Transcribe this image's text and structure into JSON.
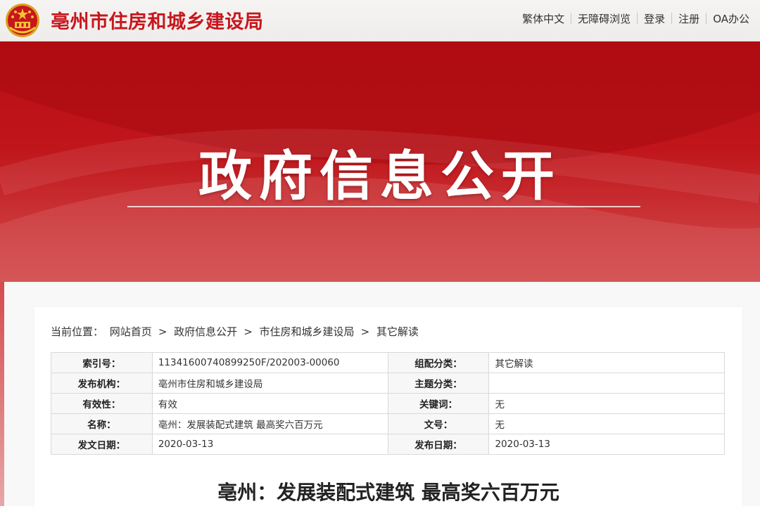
{
  "header": {
    "site_title": "亳州市住房和城乡建设局",
    "links": [
      "繁体中文",
      "无障碍浏览",
      "登录",
      "注册",
      "OA办公"
    ]
  },
  "banner": {
    "title": "政府信息公开"
  },
  "breadcrumb": {
    "prefix": "当前位置：",
    "items": [
      "网站首页",
      "政府信息公开",
      "市住房和城乡建设局",
      "其它解读"
    ]
  },
  "meta": {
    "rows": [
      {
        "k1": "索引号：",
        "v1": "11341600740899250F/202003-00060",
        "k2": "组配分类：",
        "v2": "其它解读"
      },
      {
        "k1": "发布机构：",
        "v1": "亳州市住房和城乡建设局",
        "k2": "主题分类：",
        "v2": ""
      },
      {
        "k1": "有效性：",
        "v1": "有效",
        "k2": "关键词：",
        "v2": "无"
      },
      {
        "k1": "名称：",
        "v1": "亳州：发展装配式建筑 最高奖六百万元",
        "k2": "文号：",
        "v2": "无"
      },
      {
        "k1": "发文日期：",
        "v1": "2020-03-13",
        "k2": "发布日期：",
        "v2": "2020-03-13"
      }
    ]
  },
  "article": {
    "title": "亳州：发展装配式建筑 最高奖六百万元"
  },
  "colors": {
    "brand_red": "#c8161d",
    "banner_red": "#b90d13"
  }
}
